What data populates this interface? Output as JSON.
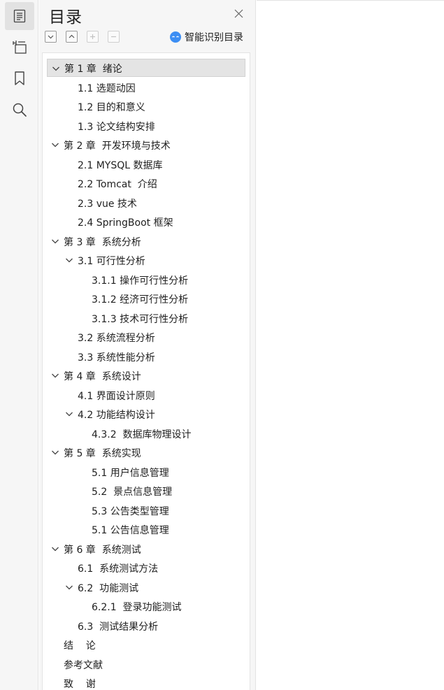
{
  "panel": {
    "title": "目录",
    "smart_label": "智能识别目录"
  },
  "toc": [
    {
      "label": "第 1 章  绪论",
      "level": 0,
      "expandable": true,
      "selected": true
    },
    {
      "label": "1.1 选题动因",
      "level": 1,
      "expandable": false
    },
    {
      "label": "1.2 目的和意义",
      "level": 1,
      "expandable": false
    },
    {
      "label": "1.3 论文结构安排",
      "level": 1,
      "expandable": false
    },
    {
      "label": "第 2 章  开发环境与技术",
      "level": 0,
      "expandable": true
    },
    {
      "label": "2.1 MYSQL 数据库",
      "level": 1,
      "expandable": false
    },
    {
      "label": "2.2 Tomcat  介绍",
      "level": 1,
      "expandable": false
    },
    {
      "label": "2.3 vue 技术",
      "level": 1,
      "expandable": false
    },
    {
      "label": "2.4 SpringBoot 框架",
      "level": 1,
      "expandable": false
    },
    {
      "label": "第 3 章  系统分析",
      "level": 0,
      "expandable": true
    },
    {
      "label": "3.1 可行性分析",
      "level": 1,
      "expandable": true
    },
    {
      "label": "3.1.1 操作可行性分析",
      "level": 2,
      "expandable": false
    },
    {
      "label": "3.1.2 经济可行性分析",
      "level": 2,
      "expandable": false
    },
    {
      "label": "3.1.3 技术可行性分析",
      "level": 2,
      "expandable": false
    },
    {
      "label": "3.2 系统流程分析",
      "level": 1,
      "expandable": false
    },
    {
      "label": "3.3 系统性能分析",
      "level": 1,
      "expandable": false
    },
    {
      "label": "第 4 章  系统设计",
      "level": 0,
      "expandable": true
    },
    {
      "label": "4.1 界面设计原则",
      "level": 1,
      "expandable": false
    },
    {
      "label": "4.2 功能结构设计",
      "level": 1,
      "expandable": true
    },
    {
      "label": "4.3.2  数据库物理设计",
      "level": 2,
      "expandable": false
    },
    {
      "label": "第 5 章  系统实现",
      "level": 0,
      "expandable": true
    },
    {
      "label": "5.1 用户信息管理",
      "level": 2,
      "expandable": false
    },
    {
      "label": "5.2  景点信息管理",
      "level": 2,
      "expandable": false
    },
    {
      "label": "5.3 公告类型管理",
      "level": 2,
      "expandable": false
    },
    {
      "label": "5.1 公告信息管理",
      "level": 2,
      "expandable": false
    },
    {
      "label": "第 6 章  系统测试",
      "level": 0,
      "expandable": true
    },
    {
      "label": "6.1  系统测试方法",
      "level": 1,
      "expandable": false
    },
    {
      "label": "6.2  功能测试",
      "level": 1,
      "expandable": true
    },
    {
      "label": "6.2.1  登录功能测试",
      "level": 2,
      "expandable": false
    },
    {
      "label": "6.3  测试结果分析",
      "level": 1,
      "expandable": false
    },
    {
      "label": "结    论",
      "level": 0,
      "expandable": false
    },
    {
      "label": "参考文献",
      "level": 0,
      "expandable": false
    },
    {
      "label": "致    谢",
      "level": 0,
      "expandable": false
    }
  ]
}
